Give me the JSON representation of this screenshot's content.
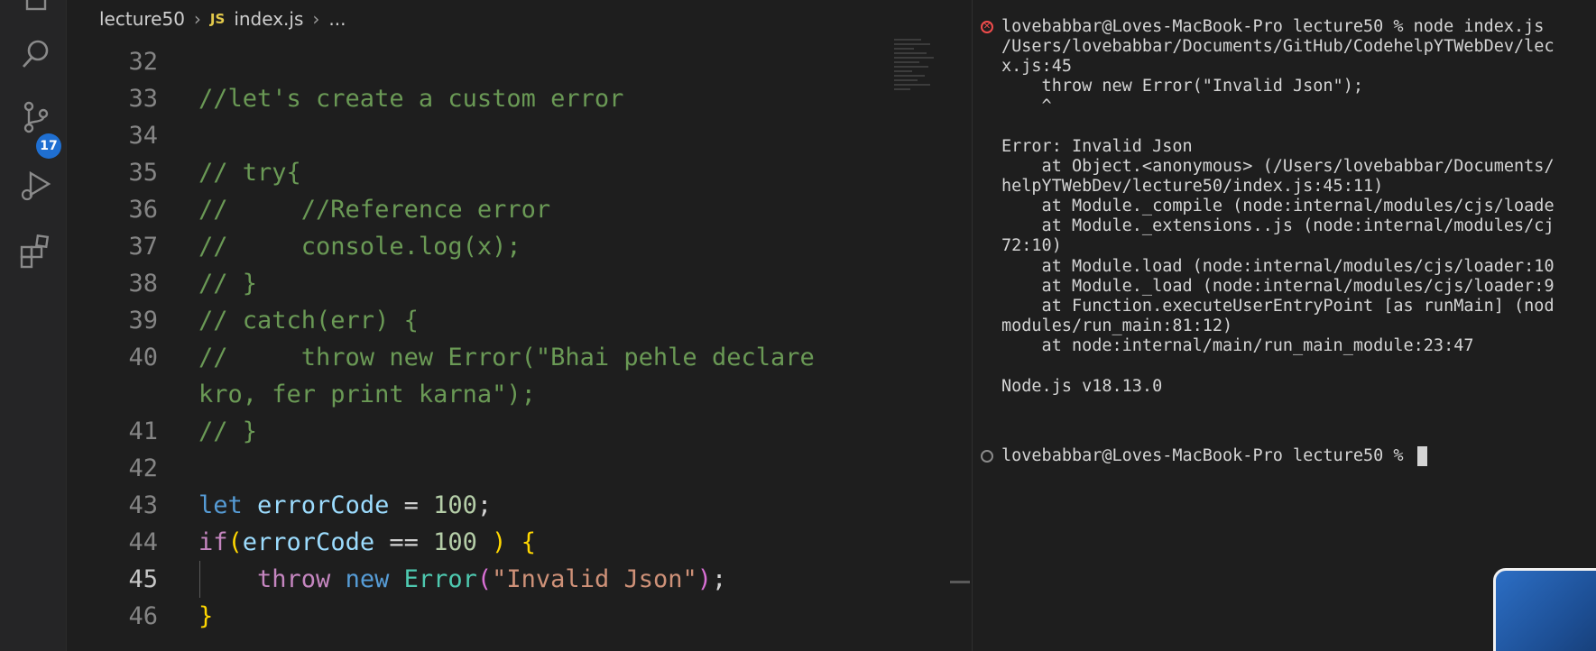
{
  "activity_bar": {
    "icons": [
      "explorer-icon",
      "search-icon",
      "source-control-icon",
      "run-debug-icon",
      "extensions-icon"
    ],
    "source_control_badge": "17"
  },
  "editor": {
    "breadcrumb": {
      "folder": "lecture50",
      "lang": "JS",
      "file": "index.js",
      "more": "..."
    },
    "lines": [
      {
        "n": "32",
        "tokens": []
      },
      {
        "n": "33",
        "tokens": [
          [
            "cmt",
            "//let's create a custom error"
          ]
        ]
      },
      {
        "n": "34",
        "tokens": []
      },
      {
        "n": "35",
        "tokens": [
          [
            "cmt",
            "// try{"
          ]
        ]
      },
      {
        "n": "36",
        "tokens": [
          [
            "cmt",
            "//     //Reference error"
          ]
        ]
      },
      {
        "n": "37",
        "tokens": [
          [
            "cmt",
            "//     console.log(x);"
          ]
        ]
      },
      {
        "n": "38",
        "tokens": [
          [
            "cmt",
            "// }"
          ]
        ]
      },
      {
        "n": "39",
        "tokens": [
          [
            "cmt",
            "// catch(err) {"
          ]
        ]
      },
      {
        "n": "40",
        "tokens": [
          [
            "cmt",
            "//     throw new Error(\"Bhai pehle declare"
          ]
        ]
      },
      {
        "n": "",
        "tokens": [
          [
            "cmt",
            "kro, fer print karna\");"
          ]
        ]
      },
      {
        "n": "41",
        "tokens": [
          [
            "cmt",
            "// }"
          ]
        ]
      },
      {
        "n": "42",
        "tokens": []
      },
      {
        "n": "43",
        "tokens": [
          [
            "kw-blue",
            "let "
          ],
          [
            "var",
            "errorCode"
          ],
          [
            "op",
            " = "
          ],
          [
            "num",
            "100"
          ],
          [
            "op",
            ";"
          ]
        ]
      },
      {
        "n": "44",
        "tokens": [
          [
            "kw-purple",
            "if"
          ],
          [
            "brace1",
            "("
          ],
          [
            "var",
            "errorCode"
          ],
          [
            "op",
            " == "
          ],
          [
            "num",
            "100"
          ],
          [
            "brace1",
            " )"
          ],
          [
            "op",
            " "
          ],
          [
            "brace1",
            "{"
          ]
        ]
      },
      {
        "n": "45",
        "active": true,
        "tokens": [
          [
            "op",
            "    "
          ],
          [
            "kw-purple",
            "throw "
          ],
          [
            "kw-blue",
            "new "
          ],
          [
            "cls",
            "Error"
          ],
          [
            "brace2",
            "("
          ],
          [
            "str",
            "\"Invalid Json\""
          ],
          [
            "brace2",
            ")"
          ],
          [
            "op",
            ";"
          ]
        ]
      },
      {
        "n": "46",
        "tokens": [
          [
            "brace1",
            "}"
          ]
        ]
      }
    ]
  },
  "terminal": {
    "lines": [
      "lovebabbar@Loves-MacBook-Pro lecture50 % node index.js",
      "/Users/lovebabbar/Documents/GitHub/CodehelpYTWebDev/lec",
      "x.js:45",
      "    throw new Error(\"Invalid Json\");",
      "    ^",
      "",
      "Error: Invalid Json",
      "    at Object.<anonymous> (/Users/lovebabbar/Documents/",
      "helpYTWebDev/lecture50/index.js:45:11)",
      "    at Module._compile (node:internal/modules/cjs/loade",
      "    at Module._extensions..js (node:internal/modules/cj",
      "72:10)",
      "    at Module.load (node:internal/modules/cjs/loader:10",
      "    at Module._load (node:internal/modules/cjs/loader:9",
      "    at Function.executeUserEntryPoint [as runMain] (nod",
      "modules/run_main:81:12)",
      "    at node:internal/main/run_main_module:23:47",
      "",
      "Node.js v18.13.0"
    ],
    "prompt": "lovebabbar@Loves-MacBook-Pro lecture50 % "
  }
}
